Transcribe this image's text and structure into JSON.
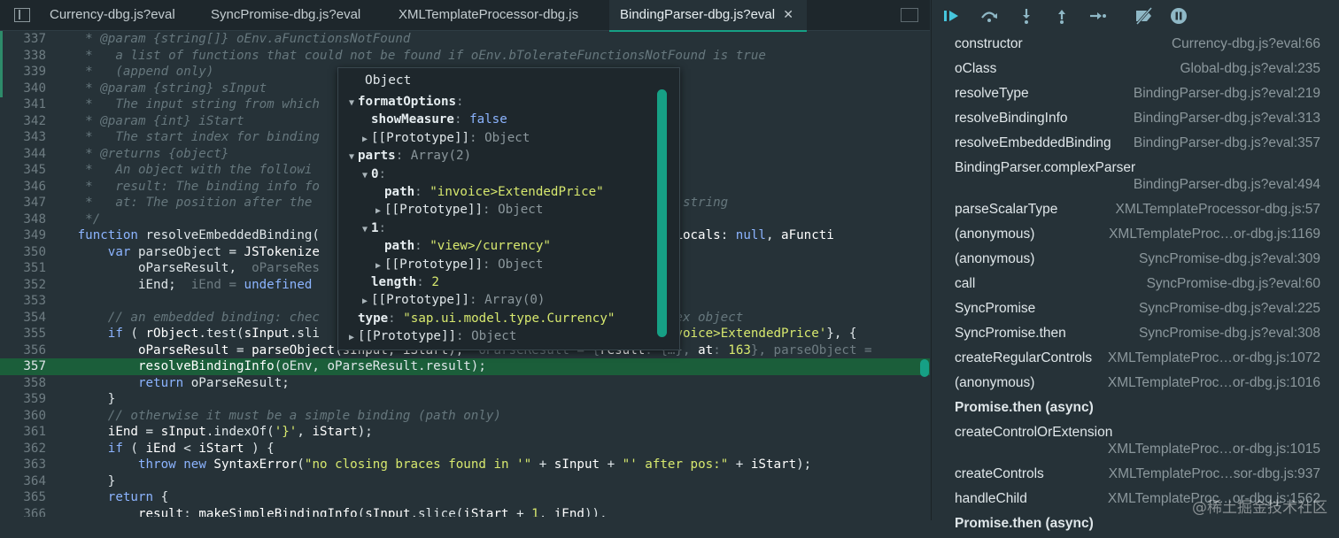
{
  "tabs": [
    {
      "label": "Currency-dbg.js?eval"
    },
    {
      "label": "SyncPromise-dbg.js?eval"
    },
    {
      "label": "XMLTemplateProcessor-dbg.js"
    },
    {
      "label": "BindingParser-dbg.js?eval",
      "active": true
    }
  ],
  "code_lines": [
    {
      "n": "337",
      "html": "    <span class='c'>* @param {string[]} oEnv.aFunctionsNotFound</span>"
    },
    {
      "n": "338",
      "html": "    <span class='c'>*   a list of functions that could not be found if oEnv.bTolerateFunctionsNotFound is true</span>"
    },
    {
      "n": "339",
      "html": "    <span class='c'>*   (append only)</span>"
    },
    {
      "n": "340",
      "html": "    <span class='c'>* @param {string} sInput</span>"
    },
    {
      "n": "341",
      "html": "    <span class='c'>*   The input string from which</span>"
    },
    {
      "n": "342",
      "html": "    <span class='c'>* @param {int} iStart</span>"
    },
    {
      "n": "343",
      "html": "    <span class='c'>*   The start index for binding</span>"
    },
    {
      "n": "344",
      "html": "    <span class='c'>* @returns {object}</span>"
    },
    {
      "n": "345",
      "html": "    <span class='c'>*   An object with the followi</span>"
    },
    {
      "n": "346",
      "html": "    <span class='c'>*   result: The binding info fo</span>"
    },
    {
      "n": "347",
      "html": "    <span class='c'>*   at: The position after the                                       the input string</span>"
    },
    {
      "n": "348",
      "html": "    <span class='c'>*/</span>"
    },
    {
      "n": "349",
      "html": "   <span class='k'>function</span> resolveEmbeddedBinding(                                     fnClass, <span class='fn'>mLocals</span>: <span class='k'>null</span>, <span class='fn'>aFuncti</span>"
    },
    {
      "n": "350",
      "html": "       <span class='k'>var</span> parseObject = <span class='fn'>JSTokenize</span>                                            <span class='ghost'>rt)</span>"
    },
    {
      "n": "351",
      "html": "           oParseResult,  <span class='ghost'>oParseRes</span>"
    },
    {
      "n": "352",
      "html": "           iEnd;  <span class='ghost'>iEnd = </span><span class='k'>undefined</span>"
    },
    {
      "n": "353",
      "html": ""
    },
    {
      "n": "354",
      "html": "       <span class='c'>// an embedded binding: chec                                        a complex object</span>"
    },
    {
      "n": "355",
      "html": "       <span class='k'>if</span> ( <span class='fn'>rObject</span>.test(<span class='fn'>sInput</span>.sli                                      <span class='fn'>path</span>: <span class='s'>'invoice&gt;ExtendedPrice'</span>}, {"
    },
    {
      "n": "356",
      "html": "           <span class='fn'>oParseResult</span> = <span class='fn'>parseObject</span>(<span class='fn'>sInput</span>, <span class='fn'>iStart</span>);  <span class='ghost'>oParseResult = {</span><span class='fn'>result</span><span class='ghost'>: {…}, </span><span class='fn'>at</span><span class='ghost'>: </span><span class='s'>163</span><span class='ghost'>}, parseObject = </span>"
    },
    {
      "n": "357",
      "html": "           <span class='fn'>resolveBindingInfo</span>(oEnv, oParseResult.result);",
      "hl": true
    },
    {
      "n": "358",
      "html": "           <span class='k'>return</span> oParseResult;"
    },
    {
      "n": "359",
      "html": "       }"
    },
    {
      "n": "360",
      "html": "       <span class='c'>// otherwise it must be a simple binding (path only)</span>"
    },
    {
      "n": "361",
      "html": "       <span class='fn'>iEnd</span> = <span class='fn'>sInput</span>.indexOf(<span class='s'>'}'</span>, <span class='fn'>iStart</span>);"
    },
    {
      "n": "362",
      "html": "       <span class='k'>if</span> ( <span class='fn'>iEnd</span> &lt; <span class='fn'>iStart</span> ) {"
    },
    {
      "n": "363",
      "html": "           <span class='k'>throw</span> <span class='k'>new</span> <span class='fn'>SyntaxError</span>(<span class='s'>\"no closing braces found in '\"</span> + <span class='fn'>sInput</span> + <span class='s'>\"' after pos:\"</span> + <span class='fn'>iStart</span>);"
    },
    {
      "n": "364",
      "html": "       }"
    },
    {
      "n": "365",
      "html": "       <span class='k'>return</span> {"
    },
    {
      "n": "366",
      "html": "           <span class='fn'>result</span>: <span class='fn'>makeSimpleBindingInfo</span>(<span class='fn'>sInput</span>.slice(<span class='fn'>iStart</span> + <span class='s'>1</span>, <span class='fn'>iEnd</span>)),"
    }
  ],
  "popover": {
    "title": "Object",
    "rows": [
      {
        "tri": "▼",
        "indent": 0,
        "html": "<span class='pk'>formatOptions</span><span class='pg'>:</span>"
      },
      {
        "tri": "",
        "indent": 1,
        "html": "<span class='pk'>showMeasure</span><span class='pg'>: </span><span class='pb'>false</span>"
      },
      {
        "tri": "▶",
        "indent": 1,
        "html": "[[Prototype]]<span class='pg'>: Object</span>"
      },
      {
        "tri": "▼",
        "indent": 0,
        "html": "<span class='pk'>parts</span><span class='pg'>: Array(2)</span>"
      },
      {
        "tri": "▼",
        "indent": 1,
        "html": "<span class='pk'>0</span><span class='pg'>:</span>"
      },
      {
        "tri": "",
        "indent": 2,
        "html": "<span class='pk'>path</span><span class='pg'>: </span><span class='pv'>\"invoice&gt;ExtendedPrice\"</span>"
      },
      {
        "tri": "▶",
        "indent": 2,
        "html": "[[Prototype]]<span class='pg'>: Object</span>"
      },
      {
        "tri": "▼",
        "indent": 1,
        "html": "<span class='pk'>1</span><span class='pg'>:</span>"
      },
      {
        "tri": "",
        "indent": 2,
        "html": "<span class='pk'>path</span><span class='pg'>: </span><span class='pv'>\"view&gt;/currency\"</span>"
      },
      {
        "tri": "▶",
        "indent": 2,
        "html": "[[Prototype]]<span class='pg'>: Object</span>"
      },
      {
        "tri": "",
        "indent": 1,
        "html": "<span class='pk'>length</span><span class='pg'>: </span><span class='pv'>2</span>"
      },
      {
        "tri": "▶",
        "indent": 1,
        "html": "[[Prototype]]<span class='pg'>: Array(0)</span>"
      },
      {
        "tri": "",
        "indent": 0,
        "html": "<span class='pk'>type</span><span class='pg'>: </span><span class='pv'>\"sap.ui.model.type.Currency\"</span>"
      },
      {
        "tri": "▶",
        "indent": 0,
        "html": "[[Prototype]]<span class='pg'>: Object</span>"
      }
    ]
  },
  "debug_toolbar": {
    "icons": [
      "resume-icon",
      "step-over-icon",
      "step-into-icon",
      "step-out-icon",
      "step-icon",
      "deactivate-breakpoints-icon",
      "pause-on-exceptions-icon"
    ]
  },
  "call_stack": [
    {
      "name": "constructor",
      "loc": "Currency-dbg.js?eval:66"
    },
    {
      "name": "oClass",
      "loc": "Global-dbg.js?eval:235"
    },
    {
      "name": "resolveType",
      "loc": "BindingParser-dbg.js?eval:219"
    },
    {
      "name": "resolveBindingInfo",
      "loc": "BindingParser-dbg.js?eval:313"
    },
    {
      "name": "resolveEmbeddedBinding",
      "loc": "BindingParser-dbg.js?eval:357"
    },
    {
      "name": "BindingParser.complexParser",
      "loc": "BindingParser-dbg.js?eval:494",
      "wrap": true
    },
    {
      "name": "parseScalarType",
      "loc": "XMLTemplateProcessor-dbg.js:57"
    },
    {
      "name": "(anonymous)",
      "loc": "XMLTemplateProc…or-dbg.js:1169"
    },
    {
      "name": "(anonymous)",
      "loc": "SyncPromise-dbg.js?eval:309"
    },
    {
      "name": "call",
      "loc": "SyncPromise-dbg.js?eval:60"
    },
    {
      "name": "SyncPromise",
      "loc": "SyncPromise-dbg.js?eval:225"
    },
    {
      "name": "SyncPromise.then",
      "loc": "SyncPromise-dbg.js?eval:308"
    },
    {
      "name": "createRegularControls",
      "loc": "XMLTemplateProc…or-dbg.js:1072"
    },
    {
      "name": "(anonymous)",
      "loc": "XMLTemplateProc…or-dbg.js:1016"
    },
    {
      "name": "Promise.then (async)",
      "loc": "",
      "async": true
    },
    {
      "name": "createControlOrExtension",
      "loc": "XMLTemplateProc…or-dbg.js:1015",
      "wrap": true
    },
    {
      "name": "createControls",
      "loc": "XMLTemplateProc…sor-dbg.js:937"
    },
    {
      "name": "handleChild",
      "loc": "XMLTemplateProc…or-dbg.js:1562"
    },
    {
      "name": "Promise.then (async)",
      "loc": "",
      "async": true
    }
  ],
  "watermark": "@稀土掘金技术社区"
}
